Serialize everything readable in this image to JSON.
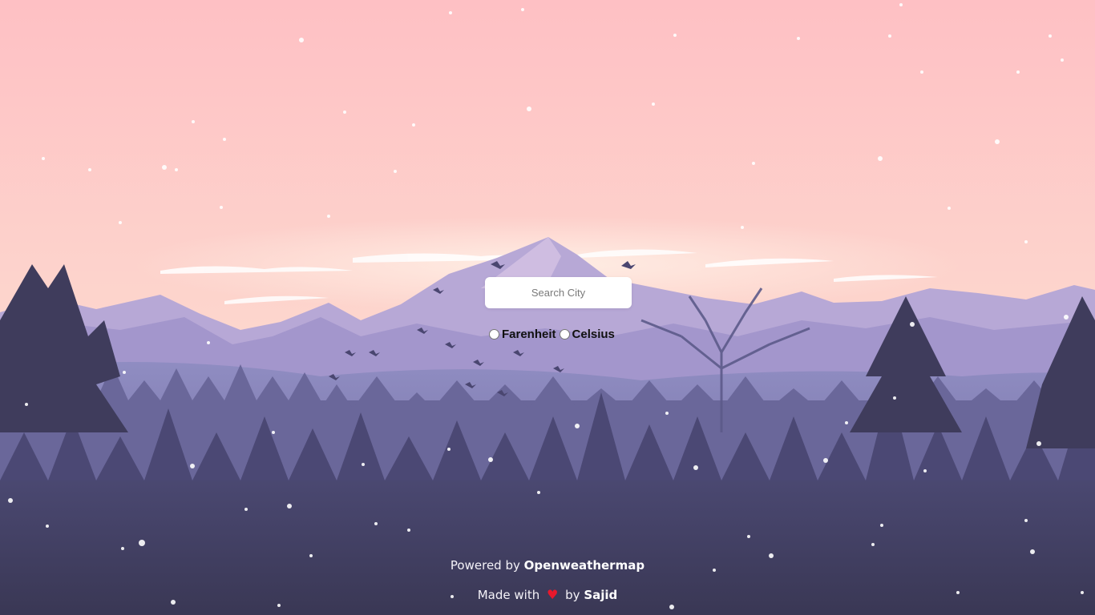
{
  "search": {
    "placeholder": "Search City",
    "value": ""
  },
  "units": [
    {
      "label": "Farenheit",
      "checked": false
    },
    {
      "label": "Celsius",
      "checked": false
    }
  ],
  "footer": {
    "powered_prefix": "Powered by",
    "powered_link": "Openweathermap",
    "made_prefix": "Made with",
    "heart_icon": "heart-icon",
    "by_text": "by",
    "author_link": "Sajid"
  },
  "colors": {
    "sky_top": "#fec2c6",
    "sky_horizon": "#fde0d2",
    "forest_dark": "#3b3a52",
    "heart": "#e8182c"
  }
}
